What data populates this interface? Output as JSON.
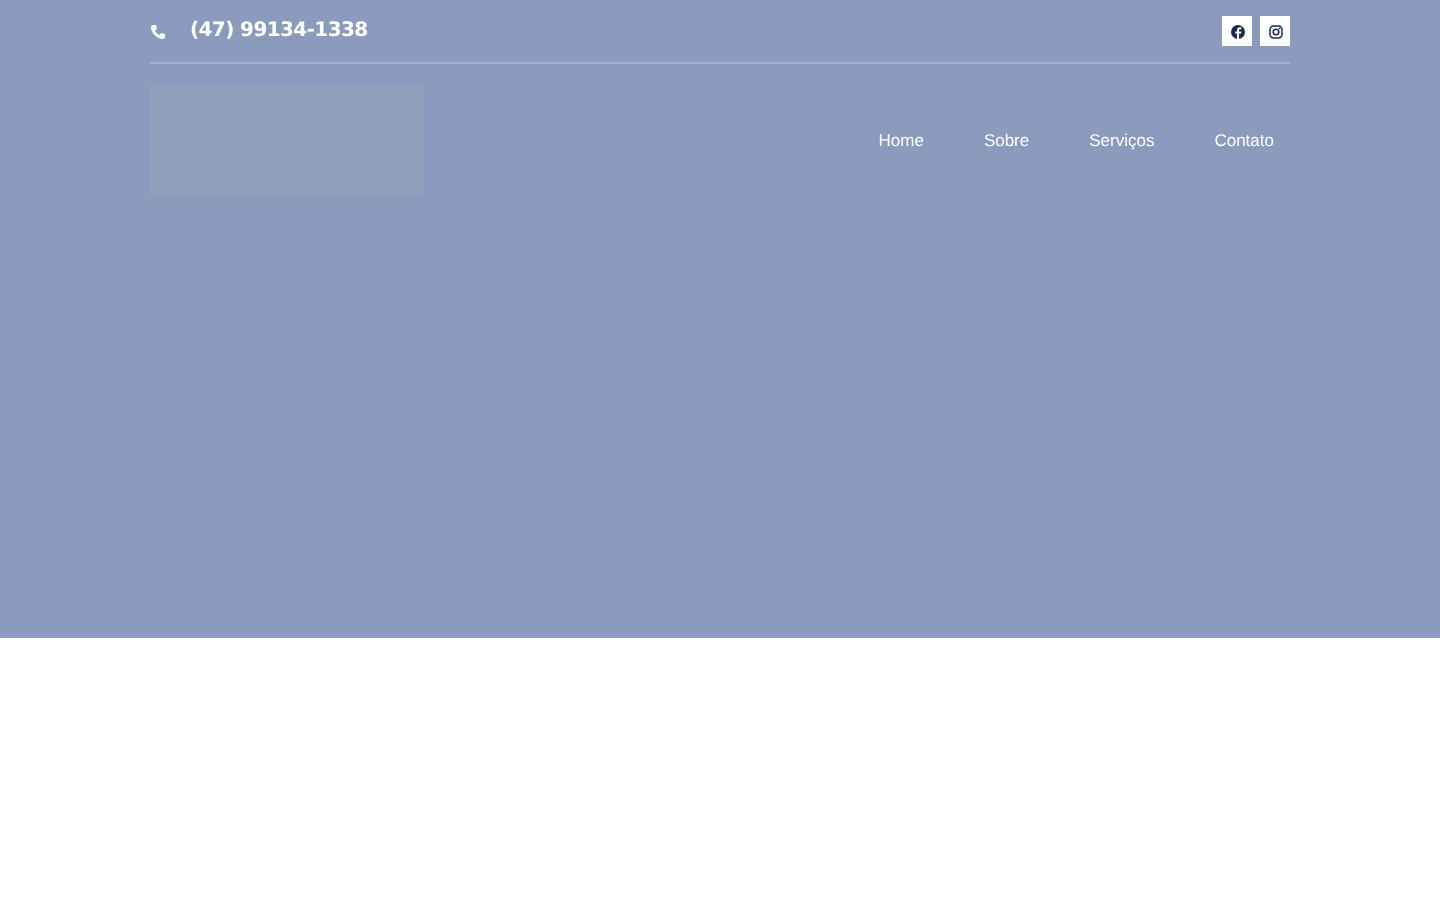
{
  "topbar": {
    "phone": "(47) 99134-1338",
    "social": [
      {
        "kind": "facebook"
      },
      {
        "kind": "instagram"
      }
    ]
  },
  "nav": [
    {
      "label": "Home"
    },
    {
      "label": "Sobre"
    },
    {
      "label": "Serviços"
    },
    {
      "label": "Contato"
    }
  ]
}
